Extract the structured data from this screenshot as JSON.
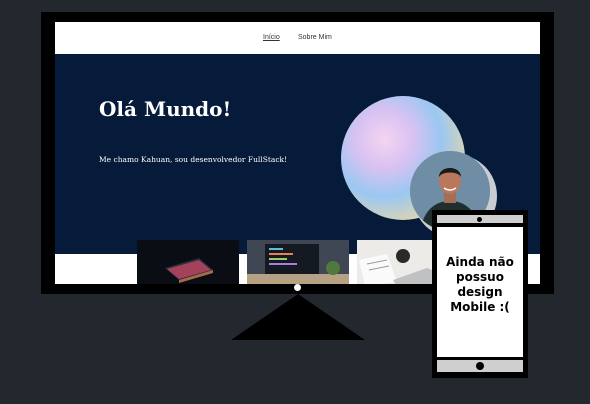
{
  "nav": {
    "items": [
      "Início",
      "Sobre Mim"
    ]
  },
  "hero": {
    "title": "Olá Mundo!",
    "subtitle": "Me chamo Kahuan, sou desenvolvedor FullStack!"
  },
  "tablet": {
    "message": "Ainda não possuo design Mobile :("
  },
  "colors": {
    "background": "#23272e",
    "hero": "#061a3a",
    "frame": "#000000"
  }
}
